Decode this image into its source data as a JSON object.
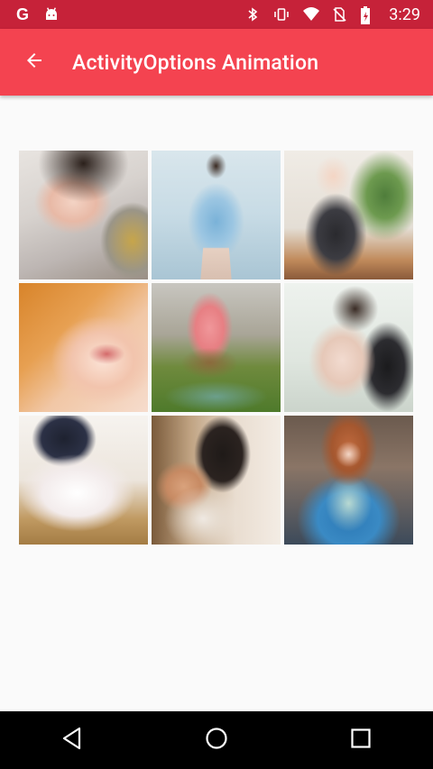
{
  "status_bar": {
    "time": "3:29",
    "left_icons": [
      "google-g-icon",
      "android-icon"
    ],
    "right_icons": [
      "bluetooth-icon",
      "vibrate-icon",
      "wifi-icon",
      "no-sim-icon",
      "battery-icon"
    ],
    "google_letter": "G"
  },
  "app_bar": {
    "title": "ActivityOptions Animation",
    "back_icon": "arrow-back-icon"
  },
  "grid": {
    "items": [
      {
        "label": "photo-1"
      },
      {
        "label": "photo-2"
      },
      {
        "label": "photo-3"
      },
      {
        "label": "photo-4"
      },
      {
        "label": "photo-5"
      },
      {
        "label": "photo-6"
      },
      {
        "label": "photo-7"
      },
      {
        "label": "photo-8"
      },
      {
        "label": "photo-9"
      }
    ]
  },
  "nav_bar": {
    "buttons": [
      "back-triangle-icon",
      "home-circle-icon",
      "recents-square-icon"
    ]
  },
  "colors": {
    "status_bar": "#c62239",
    "app_bar": "#f44350",
    "background": "#fafafa",
    "nav_bar": "#000000"
  }
}
